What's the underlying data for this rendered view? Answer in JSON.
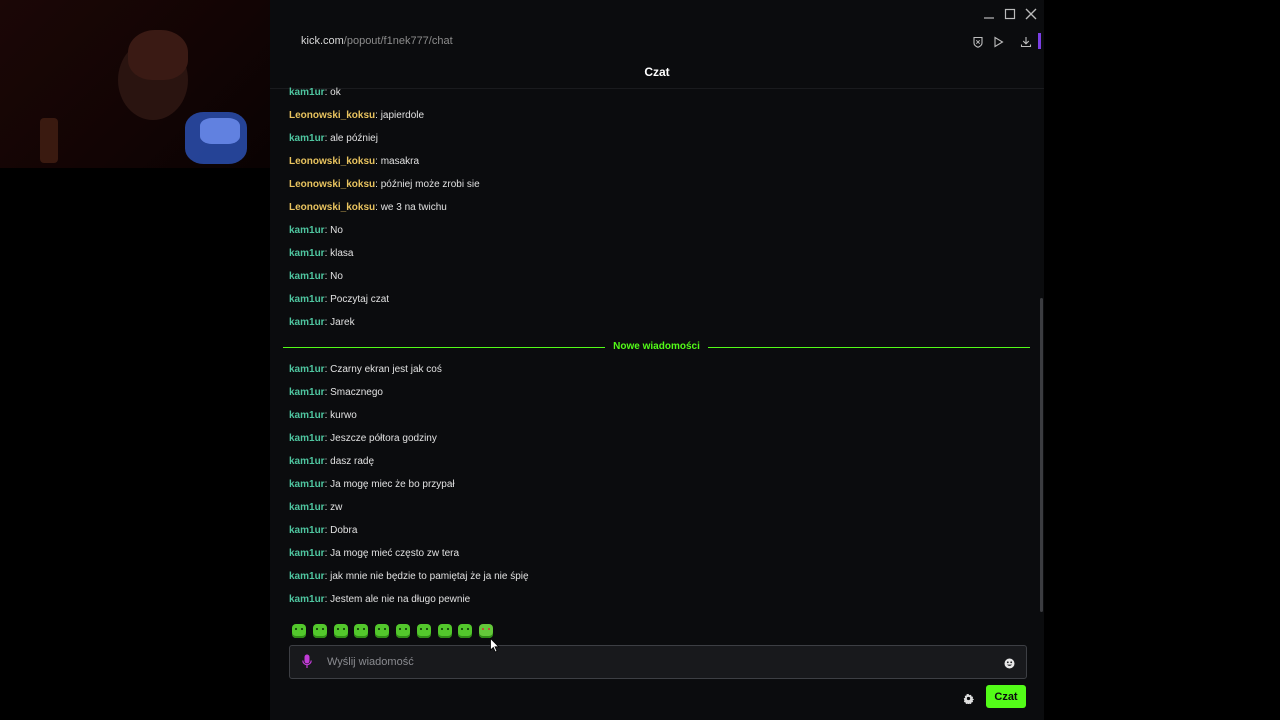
{
  "browser": {
    "url_host": "kick.com",
    "url_path": "/popout/f1nek777/chat"
  },
  "chat": {
    "title": "Czat",
    "new_messages_label": "Nowe wiadomości",
    "messages": [
      {
        "user": "kam1ur",
        "text": "ok",
        "color": "#4fc6a0"
      },
      {
        "user": "Leonowski_koksu",
        "text": "japierdole",
        "color": "#e8c35f"
      },
      {
        "user": "kam1ur",
        "text": "ale później",
        "color": "#4fc6a0"
      },
      {
        "user": "Leonowski_koksu",
        "text": "masakra",
        "color": "#e8c35f"
      },
      {
        "user": "Leonowski_koksu",
        "text": "później może zrobi sie",
        "color": "#e8c35f"
      },
      {
        "user": "Leonowski_koksu",
        "text": "we 3 na twichu",
        "color": "#e8c35f"
      },
      {
        "user": "kam1ur",
        "text": "No",
        "color": "#4fc6a0"
      },
      {
        "user": "kam1ur",
        "text": "klasa",
        "color": "#4fc6a0"
      },
      {
        "user": "kam1ur",
        "text": "No",
        "color": "#4fc6a0"
      },
      {
        "user": "kam1ur",
        "text": "Poczytaj czat",
        "color": "#4fc6a0"
      },
      {
        "user": "kam1ur",
        "text": "Jarek",
        "color": "#4fc6a0"
      },
      {
        "user": "kam1ur",
        "text": "Czarny ekran jest jak coś",
        "color": "#4fc6a0"
      },
      {
        "user": "kam1ur",
        "text": "Smacznego",
        "color": "#4fc6a0"
      },
      {
        "user": "kam1ur",
        "text": "kurwo",
        "color": "#4fc6a0"
      },
      {
        "user": "kam1ur",
        "text": "Jeszcze półtora godziny",
        "color": "#4fc6a0"
      },
      {
        "user": "kam1ur",
        "text": "dasz radę",
        "color": "#4fc6a0"
      },
      {
        "user": "kam1ur",
        "text": "Ja mogę miec że bo przypał",
        "color": "#4fc6a0"
      },
      {
        "user": "kam1ur",
        "text": "zw",
        "color": "#4fc6a0"
      },
      {
        "user": "kam1ur",
        "text": "Dobra",
        "color": "#4fc6a0"
      },
      {
        "user": "kam1ur",
        "text": "Ja mogę mieć często zw tera",
        "color": "#4fc6a0"
      },
      {
        "user": "kam1ur",
        "text": "jak mnie nie będzie to pamiętaj że ja nie śpię",
        "color": "#4fc6a0"
      },
      {
        "user": "kam1ur",
        "text": "Jestem ale nie na długo pewnie",
        "color": "#4fc6a0"
      }
    ],
    "emotes": [
      "emote-1",
      "emote-2",
      "emote-3",
      "emote-4",
      "emote-5",
      "emote-6",
      "emote-7",
      "emote-8",
      "emote-9",
      "emote-10"
    ],
    "input_placeholder": "Wyślij wiadomość",
    "send_label": "Czat"
  },
  "colors": {
    "accent_green": "#53fc18",
    "mic_purple": "#c13bd6",
    "accent_purple": "#7b3fe4"
  }
}
